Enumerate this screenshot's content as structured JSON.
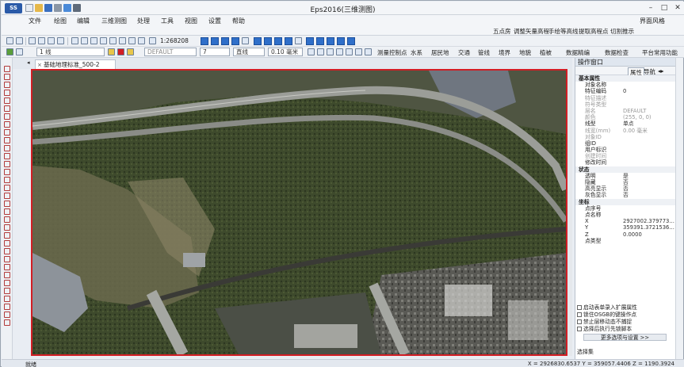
{
  "window": {
    "title": "Eps2016(三维测图)"
  },
  "menu": [
    "文件",
    "绘图",
    "编辑",
    "三维测图",
    "处理",
    "工具",
    "视图",
    "设置",
    "帮助"
  ],
  "ui_style": "界面风格",
  "ribbon": [
    "五点房",
    "调整矢量高程",
    "手绘等高线",
    "提取高程点",
    "切割推示"
  ],
  "toolbar1": {
    "scale": "1:268208"
  },
  "toolbar2": {
    "line_style": "1 线",
    "layer": "DEFAULT",
    "color_code": "7",
    "line_type": "直线",
    "width": "0.10 毫米",
    "menus": [
      "测量控制点",
      "水系",
      "居民地",
      "交通",
      "管线",
      "境界",
      "地貌",
      "植被"
    ],
    "data_check_left": "数据精编",
    "data_check": "数据检查",
    "platform": "平台常用功能"
  },
  "doc_tab": {
    "label": "基础地理标准_500-2"
  },
  "panel": {
    "title": "操作窗口",
    "tabs": {
      "attr": "属性",
      "nav": "导航"
    },
    "props": [
      {
        "k": "基本属性",
        "v": "",
        "type": "section"
      },
      {
        "k": "对象名称",
        "v": ""
      },
      {
        "k": "特征编码",
        "v": "0"
      },
      {
        "k": "特征描述",
        "v": "",
        "type": "disabled"
      },
      {
        "k": "符号类型",
        "v": "",
        "type": "disabled"
      },
      {
        "k": "层名",
        "v": "DEFAULT",
        "type": "disabled"
      },
      {
        "k": "颜色",
        "v": "(255, 0, 0)",
        "type": "disabled"
      },
      {
        "k": "线型",
        "v": "单点"
      },
      {
        "k": "线宽(mm)",
        "v": "0.00 毫米",
        "type": "disabled"
      },
      {
        "k": "对象ID",
        "v": "",
        "type": "disabled"
      },
      {
        "k": "组ID",
        "v": ""
      },
      {
        "k": "用户标识",
        "v": ""
      },
      {
        "k": "创建时间",
        "v": "",
        "type": "disabled"
      },
      {
        "k": "修改时间",
        "v": ""
      },
      {
        "k": "状态",
        "v": "",
        "type": "section"
      },
      {
        "k": "透明",
        "v": "是"
      },
      {
        "k": "隐藏",
        "v": "否"
      },
      {
        "k": "高亮显示",
        "v": "否"
      },
      {
        "k": "灰色显示",
        "v": "否"
      },
      {
        "k": "坐标",
        "v": "",
        "type": "section"
      },
      {
        "k": "点序号",
        "v": ""
      },
      {
        "k": "点名称",
        "v": ""
      },
      {
        "k": "X",
        "v": "2927002.379773..."
      },
      {
        "k": "Y",
        "v": "359391.3721536..."
      },
      {
        "k": "Z",
        "v": "0.0000"
      },
      {
        "k": "点类型",
        "v": ""
      }
    ],
    "options": [
      "启动表单录入扩展属性",
      "锁住OSGB的键操作点",
      "禁止层移动态不捕捉",
      "选择后执行先锁脚本"
    ],
    "more_options": "更多选项与设置 >>",
    "select_set": "选择集"
  },
  "status": {
    "text": "就绪",
    "coords": "X = 2926830.6537 Y = 359057.4406 Z = 1190.3924"
  }
}
